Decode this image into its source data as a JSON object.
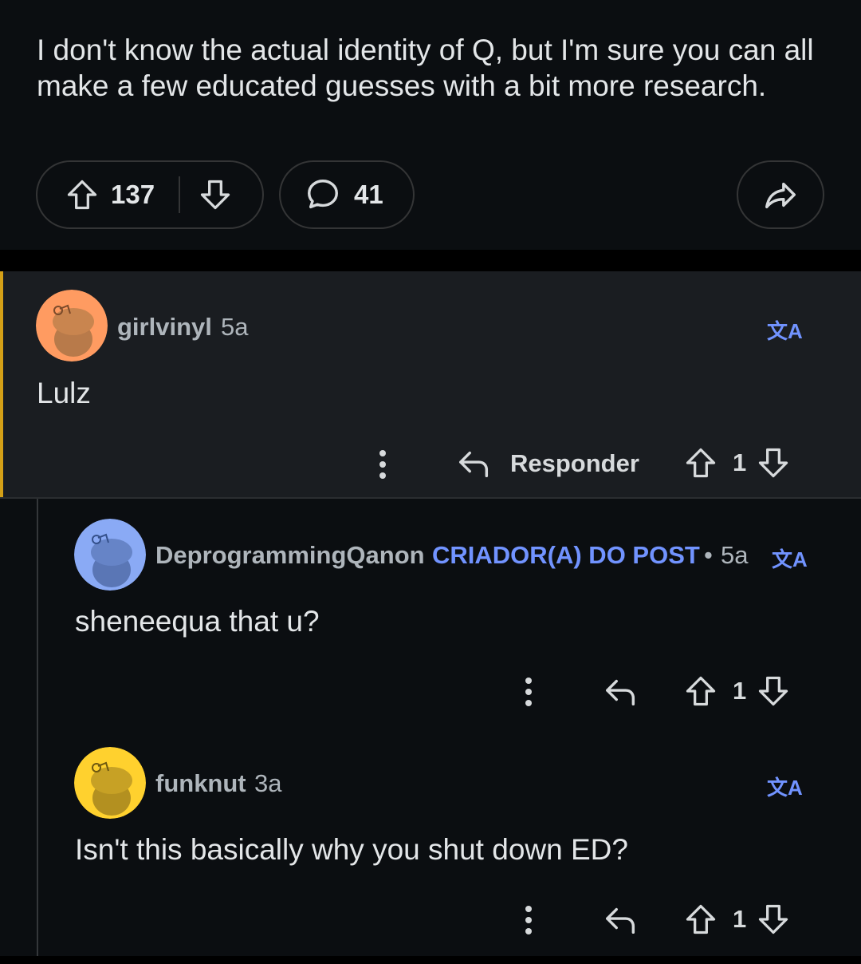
{
  "post": {
    "body": "I don't know the actual identity of Q, but I'm sure you can all make a few educated guesses with a bit more research.",
    "upvotes": "137",
    "comments": "41"
  },
  "comments": [
    {
      "username": "girlvinyl",
      "time": "5a",
      "text": "Lulz",
      "reply_label": "Responder",
      "votes": "1",
      "avatar_color": "#ff9b61"
    },
    {
      "username": "DeprogrammingQanon",
      "op_badge": "CRIADOR(A) DO POST",
      "separator": "•",
      "time": "5a",
      "text": "sheneequa that u?",
      "votes": "1",
      "avatar_color": "#8aaaf5"
    },
    {
      "username": "funknut",
      "time": "3a",
      "text": "Isn't this basically why you shut down ED?",
      "votes": "1",
      "avatar_color": "#ffd12e"
    }
  ],
  "translate_icon": "文A",
  "colors": {
    "accent": "#7193ff",
    "thread_bar": "#d4a017"
  }
}
